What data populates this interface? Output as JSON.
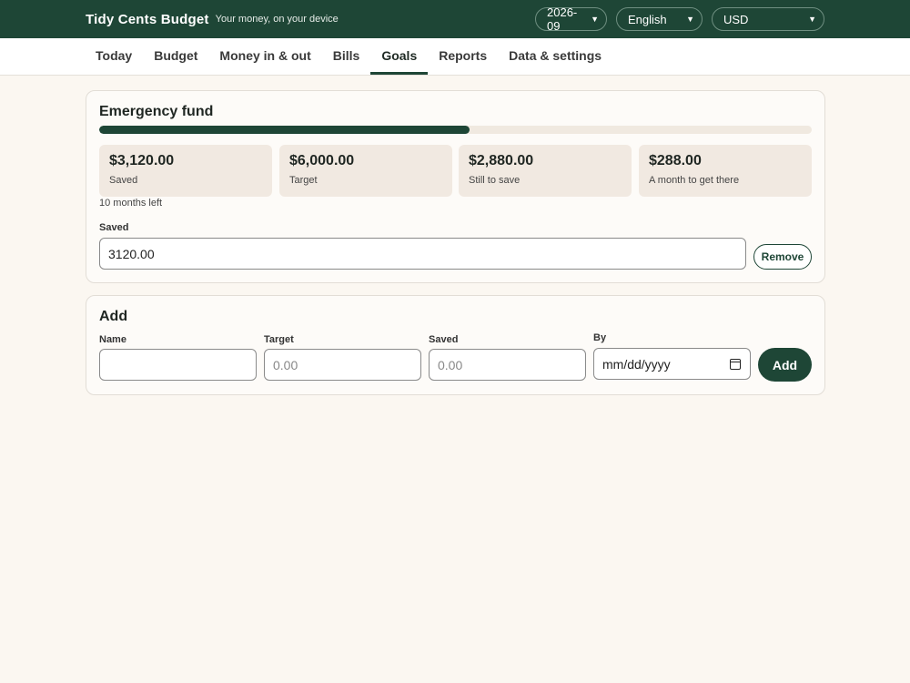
{
  "header": {
    "title": "Tidy Cents Budget",
    "tagline": "Your money, on your device",
    "month_select": "2026-09",
    "language_select": "English",
    "currency_select": "USD"
  },
  "tabs": [
    {
      "label": "Today",
      "active": false
    },
    {
      "label": "Budget",
      "active": false
    },
    {
      "label": "Money in & out",
      "active": false
    },
    {
      "label": "Bills",
      "active": false
    },
    {
      "label": "Goals",
      "active": true
    },
    {
      "label": "Reports",
      "active": false
    },
    {
      "label": "Data & settings",
      "active": false
    }
  ],
  "goal": {
    "name": "Emergency fund",
    "progress_fraction": 0.52,
    "stats": [
      {
        "value": "$3,120.00",
        "label": "Saved"
      },
      {
        "value": "$6,000.00",
        "label": "Target"
      },
      {
        "value": "$2,880.00",
        "label": "Still to save"
      },
      {
        "value": "$288.00",
        "label": "A month to get there"
      }
    ],
    "time_left": "10 months left",
    "saved_field_label": "Saved",
    "saved_field_value": "3120.00",
    "remove_label": "Remove"
  },
  "add_form": {
    "title": "Add",
    "name_label": "Name",
    "name_value": "",
    "target_label": "Target",
    "target_placeholder": "0.00",
    "saved_label": "Saved",
    "saved_placeholder": "0.00",
    "by_label": "By",
    "by_placeholder": "mm/dd/yyyy",
    "add_button": "Add"
  },
  "colors": {
    "brand": "#1e4636",
    "background": "#fbf7f1",
    "stat_tile": "#f1e9e1"
  },
  "icons": [
    "chevron-down-icon",
    "calendar-icon"
  ]
}
